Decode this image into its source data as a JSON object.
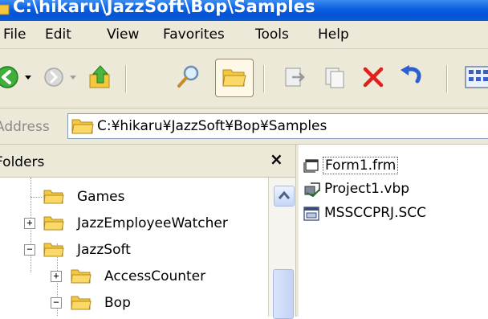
{
  "window": {
    "title": "C:\\hikaru\\JazzSoft\\Bop\\Samples"
  },
  "menu": {
    "items": [
      {
        "label": "File"
      },
      {
        "label": "Edit"
      },
      {
        "label": "View"
      },
      {
        "label": "Favorites"
      },
      {
        "label": "Tools"
      },
      {
        "label": "Help"
      }
    ]
  },
  "toolbar": {
    "buttons": [
      "back-icon",
      "forward-icon",
      "up-icon",
      "search-icon",
      "folders-icon",
      "move-to-icon",
      "copy-to-icon",
      "delete-icon",
      "undo-icon",
      "views-icon"
    ]
  },
  "address": {
    "label": "Address",
    "path": "C:¥hikaru¥JazzSoft¥Bop¥Samples"
  },
  "folders": {
    "title": "Folders",
    "close": "×",
    "items": [
      {
        "label": "Games"
      },
      {
        "label": "JazzEmployeeWatcher"
      },
      {
        "label": "JazzSoft"
      },
      {
        "label": "AccessCounter"
      },
      {
        "label": "Bop"
      }
    ]
  },
  "files": [
    {
      "label": "Form1.frm"
    },
    {
      "label": "Project1.vbp"
    },
    {
      "label": "MSSCCPRJ.SCC"
    }
  ],
  "colors": {
    "titlebar": "#0454d6",
    "chrome": "#ece9d8",
    "folder": "#f4c73e"
  }
}
